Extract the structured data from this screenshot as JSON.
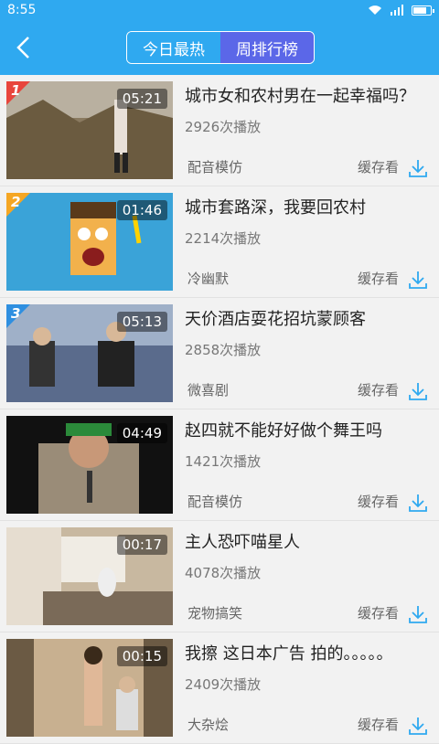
{
  "status": {
    "time": "8:55",
    "battery_level": 0.85
  },
  "navbar": {
    "tabs": [
      "今日最热",
      "周排行榜"
    ],
    "active_tab": 1
  },
  "items": [
    {
      "rank": "1",
      "duration": "05:21",
      "title": "城市女和农村男在一起幸福吗？",
      "plays": "2926次播放",
      "category": "配音模仿",
      "cache_label": "缓存看"
    },
    {
      "rank": "2",
      "duration": "01:46",
      "title": "城市套路深，我要回农村",
      "plays": "2214次播放",
      "category": "冷幽默",
      "cache_label": "缓存看"
    },
    {
      "rank": "3",
      "duration": "05:13",
      "title": "天价酒店耍花招坑蒙顾客",
      "plays": "2858次播放",
      "category": "微喜剧",
      "cache_label": "缓存看"
    },
    {
      "rank": "",
      "duration": "04:49",
      "title": "赵四就不能好好做个舞王吗",
      "plays": "1421次播放",
      "category": "配音模仿",
      "cache_label": "缓存看"
    },
    {
      "rank": "",
      "duration": "00:17",
      "title": "主人恐吓喵星人",
      "plays": "4078次播放",
      "category": "宠物搞笑",
      "cache_label": "缓存看"
    },
    {
      "rank": "",
      "duration": "00:15",
      "title": "我擦 这日本广告 拍的。。。。。",
      "plays": "2409次播放",
      "category": "大杂烩",
      "cache_label": "缓存看"
    }
  ],
  "colors": {
    "header": "#2fa9f0",
    "active_tab": "#5b67e8",
    "rank1": "#e8453c",
    "rank2": "#f5a623",
    "rank3": "#2f8fe0",
    "download": "#2fa9f0"
  }
}
